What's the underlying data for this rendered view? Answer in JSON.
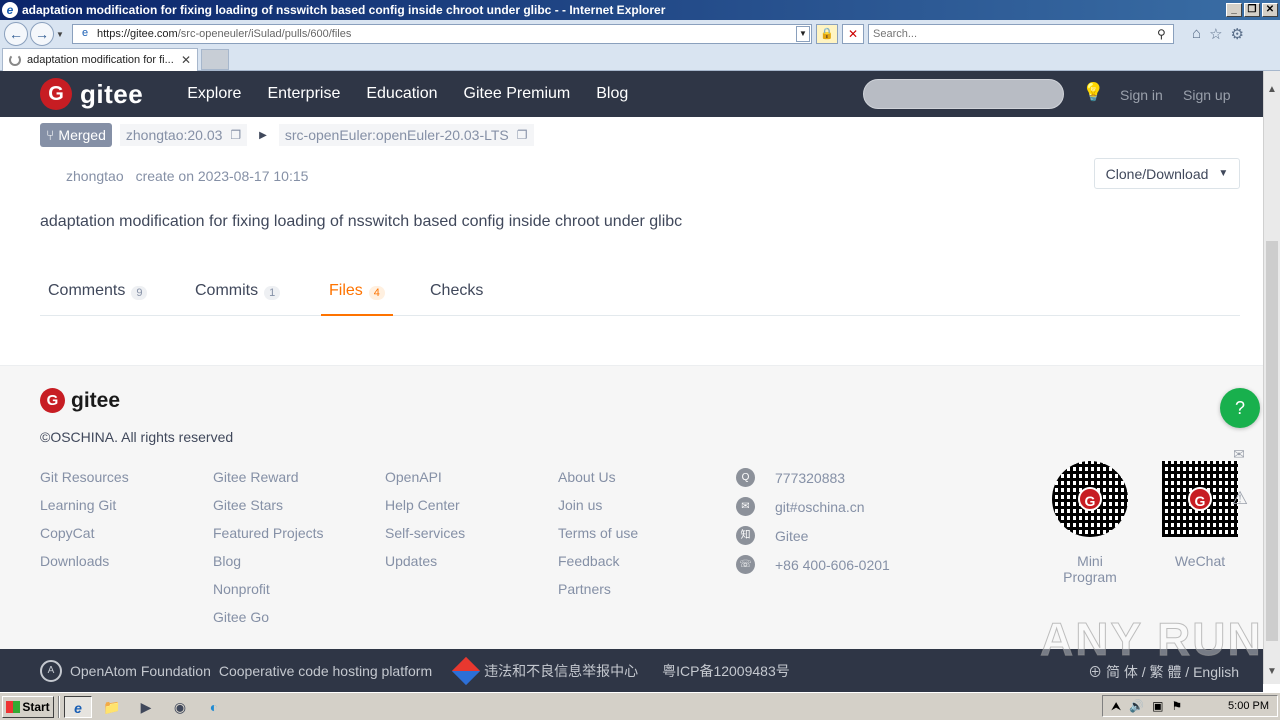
{
  "browser": {
    "window_title": "adaptation modification for fixing loading of nsswitch based config inside chroot under glibc - - Internet Explorer",
    "url_prefix": "https://gitee.com",
    "url_path": "/src-openeuler/iSulad/pulls/600/files",
    "search_placeholder": "Search...",
    "tab_title": "adaptation modification for fi..."
  },
  "header": {
    "logo_text": "gitee",
    "nav": [
      "Explore",
      "Enterprise",
      "Education",
      "Gitee Premium",
      "Blog"
    ],
    "sign_in": "Sign in",
    "sign_up": "Sign up"
  },
  "pr": {
    "status": "Merged",
    "source_branch": "zhongtao:20.03",
    "target_branch": "src-openEuler:openEuler-20.03-LTS",
    "author": "zhongtao",
    "created": "create on 2023-08-17 10:15",
    "clone_label": "Clone/Download",
    "title": "adaptation modification for fixing loading of nsswitch based config inside chroot under glibc",
    "tabs": [
      {
        "label": "Comments",
        "count": "9"
      },
      {
        "label": "Commits",
        "count": "1"
      },
      {
        "label": "Files",
        "count": "4"
      },
      {
        "label": "Checks",
        "count": ""
      }
    ]
  },
  "footer": {
    "logo_text": "gitee",
    "copyright": "©OSCHINA. All rights reserved",
    "col1": [
      "Git Resources",
      "Learning Git",
      "CopyCat",
      "Downloads"
    ],
    "col2": [
      "Gitee Reward",
      "Gitee Stars",
      "Featured Projects",
      "Blog",
      "Nonprofit",
      "Gitee Go"
    ],
    "col3": [
      "OpenAPI",
      "Help Center",
      "Self-services",
      "Updates"
    ],
    "col4": [
      "About Us",
      "Join us",
      "Terms of use",
      "Feedback",
      "Partners"
    ],
    "contacts": [
      "777320883",
      "git#oschina.cn",
      "Gitee",
      "+86 400-606-0201"
    ],
    "qr_mini": "Mini Program",
    "qr_wechat": "WeChat",
    "foundation": "OpenAtom Foundation",
    "platform": "Cooperative code hosting platform",
    "report": "违法和不良信息举报中心",
    "icp": "粤ICP备12009483号",
    "lang": "简 体 / 繁 體 / English"
  },
  "taskbar": {
    "start": "Start",
    "time": "5:00 PM"
  },
  "watermark": "ANY RUN"
}
